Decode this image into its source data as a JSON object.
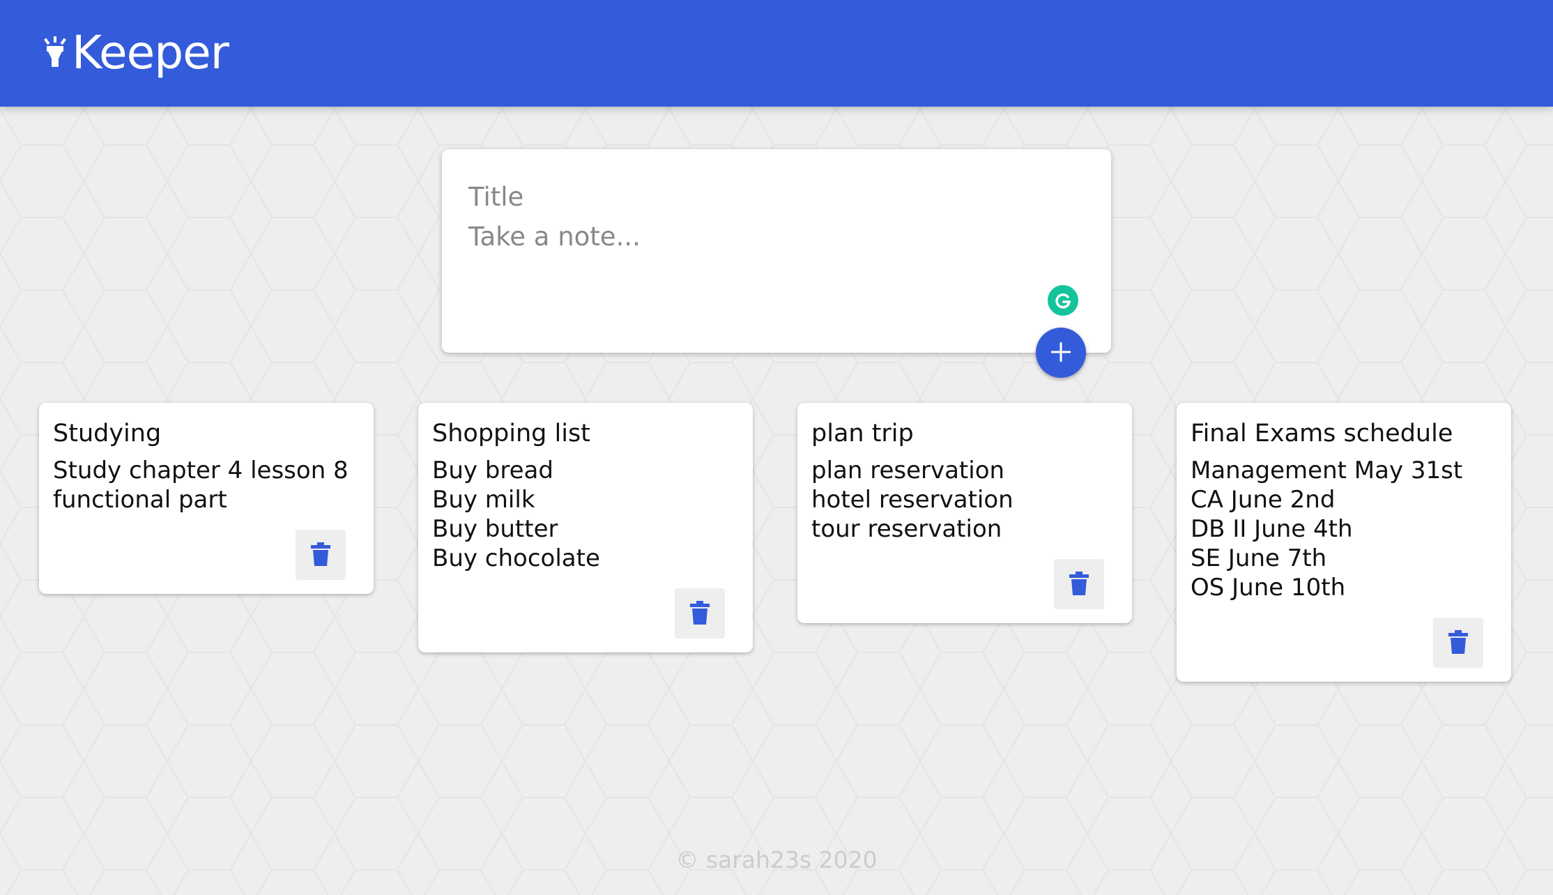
{
  "header": {
    "title": "Keeper"
  },
  "create_note": {
    "title_placeholder": "Title",
    "content_placeholder": "Take a note..."
  },
  "notes": [
    {
      "title": "Studying",
      "content": "Study chapter 4 lesson 8\nfunctional part"
    },
    {
      "title": "Shopping list",
      "content": "Buy bread\nBuy milk\nBuy butter\nBuy chocolate"
    },
    {
      "title": "plan trip",
      "content": "plan reservation\nhotel reservation\ntour reservation"
    },
    {
      "title": "Final Exams schedule",
      "content": "Management May 31st\nCA June 2nd\nDB II June 4th\nSE June 7th\nOS June 10th"
    }
  ],
  "footer": {
    "copyright": "© sarah23s 2020"
  },
  "colors": {
    "primary": "#335bda",
    "background": "#eeeeee",
    "card": "#ffffff",
    "grammarly": "#15c39a"
  },
  "icons": {
    "brand": "highlight-icon",
    "add": "plus-icon",
    "delete": "trash-icon",
    "grammarly": "grammarly-icon"
  }
}
